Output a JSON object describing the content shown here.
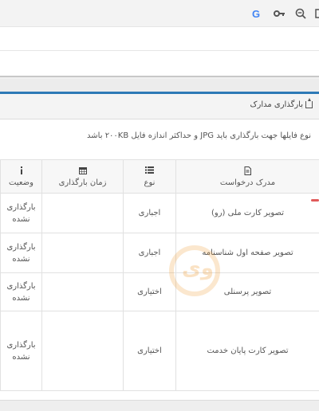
{
  "browser": {
    "icons": [
      "google-icon",
      "key-icon",
      "zoom-out-icon",
      "window-icon"
    ],
    "google_glyph": "G"
  },
  "panel": {
    "title": "بارگذاری مدارک",
    "note": "نوع فایلها جهت بارگذاری باید JPG و حداکثر اندازه فایل ۲۰۰KB باشد"
  },
  "table": {
    "headers": {
      "document": "مدرک درخواست",
      "type": "نوع",
      "upload_time": "زمان بارگذاری",
      "status": "وضعیت"
    },
    "rows": [
      {
        "document": "تصویر کارت ملی (رو)",
        "type": "اجباری",
        "upload_time": "",
        "status": "بارگذاری نشده"
      },
      {
        "document": "تصویر صفحه اول شناسنامه",
        "type": "اجباری",
        "upload_time": "",
        "status": "بارگذاری نشده"
      },
      {
        "document": "تصویر پرسنلی",
        "type": "اختیاری",
        "upload_time": "",
        "status": "بارگذاری نشده"
      },
      {
        "document": "تصویر کارت پایان خدمت",
        "type": "اختیاری",
        "upload_time": "",
        "status": "بارگذاری نشده"
      }
    ]
  },
  "colors": {
    "accent_blue": "#2d79b6",
    "indicator_red": "#e05a5a"
  }
}
